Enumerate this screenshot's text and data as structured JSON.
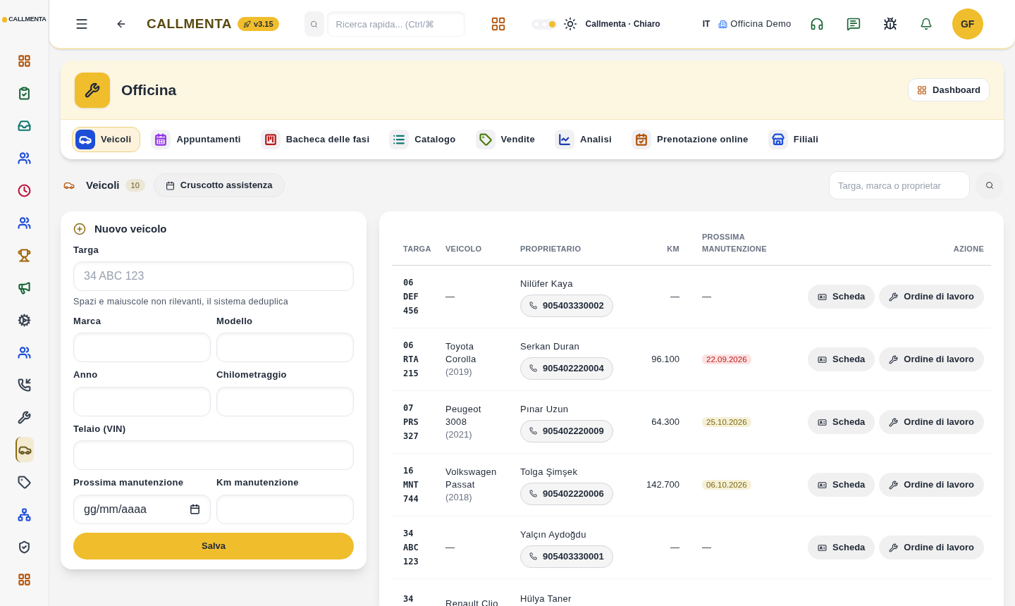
{
  "sidebar": {
    "logo": "CALLMENTA",
    "items": [
      {
        "color": "#b45309",
        "selected": false
      },
      {
        "color": "#166534",
        "selected": false
      },
      {
        "color": "#0f766e",
        "selected": false
      },
      {
        "color": "#1d4ed8",
        "selected": false
      },
      {
        "color": "#be123c",
        "selected": false
      },
      {
        "color": "#1d4ed8",
        "selected": false
      },
      {
        "color": "#a16207",
        "selected": false
      },
      {
        "color": "#166534",
        "selected": false
      },
      {
        "color": "#374151",
        "selected": false
      },
      {
        "color": "#1d4ed8",
        "selected": false
      },
      {
        "color": "#374151",
        "selected": false
      },
      {
        "color": "#374151",
        "selected": false
      },
      {
        "color": "#6b5a20",
        "selected": true
      },
      {
        "color": "#374151",
        "selected": false
      },
      {
        "color": "#1d4ed8",
        "selected": false
      },
      {
        "color": "#374151",
        "selected": false
      },
      {
        "color": "#b45309",
        "selected": false
      }
    ]
  },
  "topbar": {
    "brand": "CALLMENTA",
    "version": "v3.15",
    "search_placeholder": "Ricerca rapida... (Ctrl/⌘",
    "theme_options": [
      {
        "selected": false
      },
      {
        "selected": false
      },
      {
        "selected": true
      }
    ],
    "theme": "Callmenta · Chiaro",
    "language": "IT",
    "company": "Officina Demo",
    "avatar": "GF"
  },
  "page": {
    "title": "Officina",
    "dashboard_button": "Dashboard"
  },
  "tabs": [
    {
      "label": "Veicoli",
      "color": "#1d4ed8",
      "selected": true
    },
    {
      "label": "Appuntamenti",
      "color": "#9333ea",
      "selected": false
    },
    {
      "label": "Bacheca delle fasi",
      "color": "#b91c1c",
      "selected": false
    },
    {
      "label": "Catalogo",
      "color": "#0f766e",
      "selected": false
    },
    {
      "label": "Vendite",
      "color": "#4d7c0f",
      "selected": false
    },
    {
      "label": "Analisi",
      "color": "#1e40af",
      "selected": false
    },
    {
      "label": "Prenotazione online",
      "color": "#b45309",
      "selected": false
    },
    {
      "label": "Filiali",
      "color": "#1d4ed8",
      "selected": false
    }
  ],
  "subbar": {
    "title": "Veicoli",
    "count": "10",
    "assist_button": "Cruscotto assistenza",
    "search_placeholder": "Targa, marca o proprietar"
  },
  "form": {
    "title": "Nuovo veicolo",
    "fields": [
      {
        "label": "Targa",
        "placeholder": "34 ABC 123",
        "hint": "Spazi e maiuscole non rilevanti, il sistema deduplica",
        "kind": "wide"
      },
      {
        "label": "Marca",
        "kind": "half"
      },
      {
        "label": "Modello",
        "kind": "half"
      },
      {
        "label": "Anno",
        "kind": "half"
      },
      {
        "label": "Chilometraggio",
        "kind": "half"
      },
      {
        "label": "Telaio (VIN)",
        "kind": "wide"
      },
      {
        "label": "Prossima manutenzione",
        "kind": "date",
        "placeholder": "gg/mm/aaaa"
      },
      {
        "label": "Km manutenzione",
        "kind": "half"
      }
    ],
    "save": "Salva"
  },
  "table": {
    "columns": [
      "TARGA",
      "VEICOLO",
      "PROPRIETARIO",
      "KM",
      "PROSSIMA MANUTENZIONE",
      "AZIONE"
    ],
    "rows": [
      {
        "plate": [
          "06",
          "DEF",
          "456"
        ],
        "vehicle": "—",
        "owner": "Nilüfer Kaya",
        "phone": "905403330002",
        "km": "—",
        "maintenance": "—",
        "kind": "plain",
        "actions": [
          "Scheda",
          "Ordine di lavoro"
        ]
      },
      {
        "plate": [
          "06",
          "RTA",
          "215"
        ],
        "vehicle": "Toyota Corolla",
        "year": "(2019)",
        "owner": "Serkan Duran",
        "phone": "905402220004",
        "km": "96.100",
        "maintenance": "22.09.2026",
        "kind": "overdue",
        "actions": [
          "Scheda",
          "Ordine di lavoro"
        ]
      },
      {
        "plate": [
          "07",
          "PRS",
          "327"
        ],
        "vehicle": "Peugeot 3008",
        "year": "(2021)",
        "owner": "Pınar Uzun",
        "phone": "905402220009",
        "km": "64.300",
        "maintenance": "25.10.2026",
        "kind": "due",
        "actions": [
          "Scheda",
          "Ordine di lavoro"
        ]
      },
      {
        "plate": [
          "16",
          "MNT",
          "744"
        ],
        "vehicle": "Volkswagen Passat",
        "year": "(2018)",
        "owner": "Tolga Şimşek",
        "phone": "905402220006",
        "km": "142.700",
        "maintenance": "06.10.2026",
        "kind": "due",
        "actions": [
          "Scheda",
          "Ordine di lavoro"
        ]
      },
      {
        "plate": [
          "34",
          "ABC",
          "123"
        ],
        "vehicle": "—",
        "owner": "Yalçın Aydoğdu",
        "phone": "905403330001",
        "km": "—",
        "maintenance": "—",
        "kind": "plain",
        "actions": [
          "Scheda",
          "Ordine di lavoro"
        ]
      },
      {
        "plate": [
          "34"
        ],
        "vehicle": "Renault Clio",
        "owner": "Hülya Taner",
        "kind": "partial"
      }
    ]
  }
}
